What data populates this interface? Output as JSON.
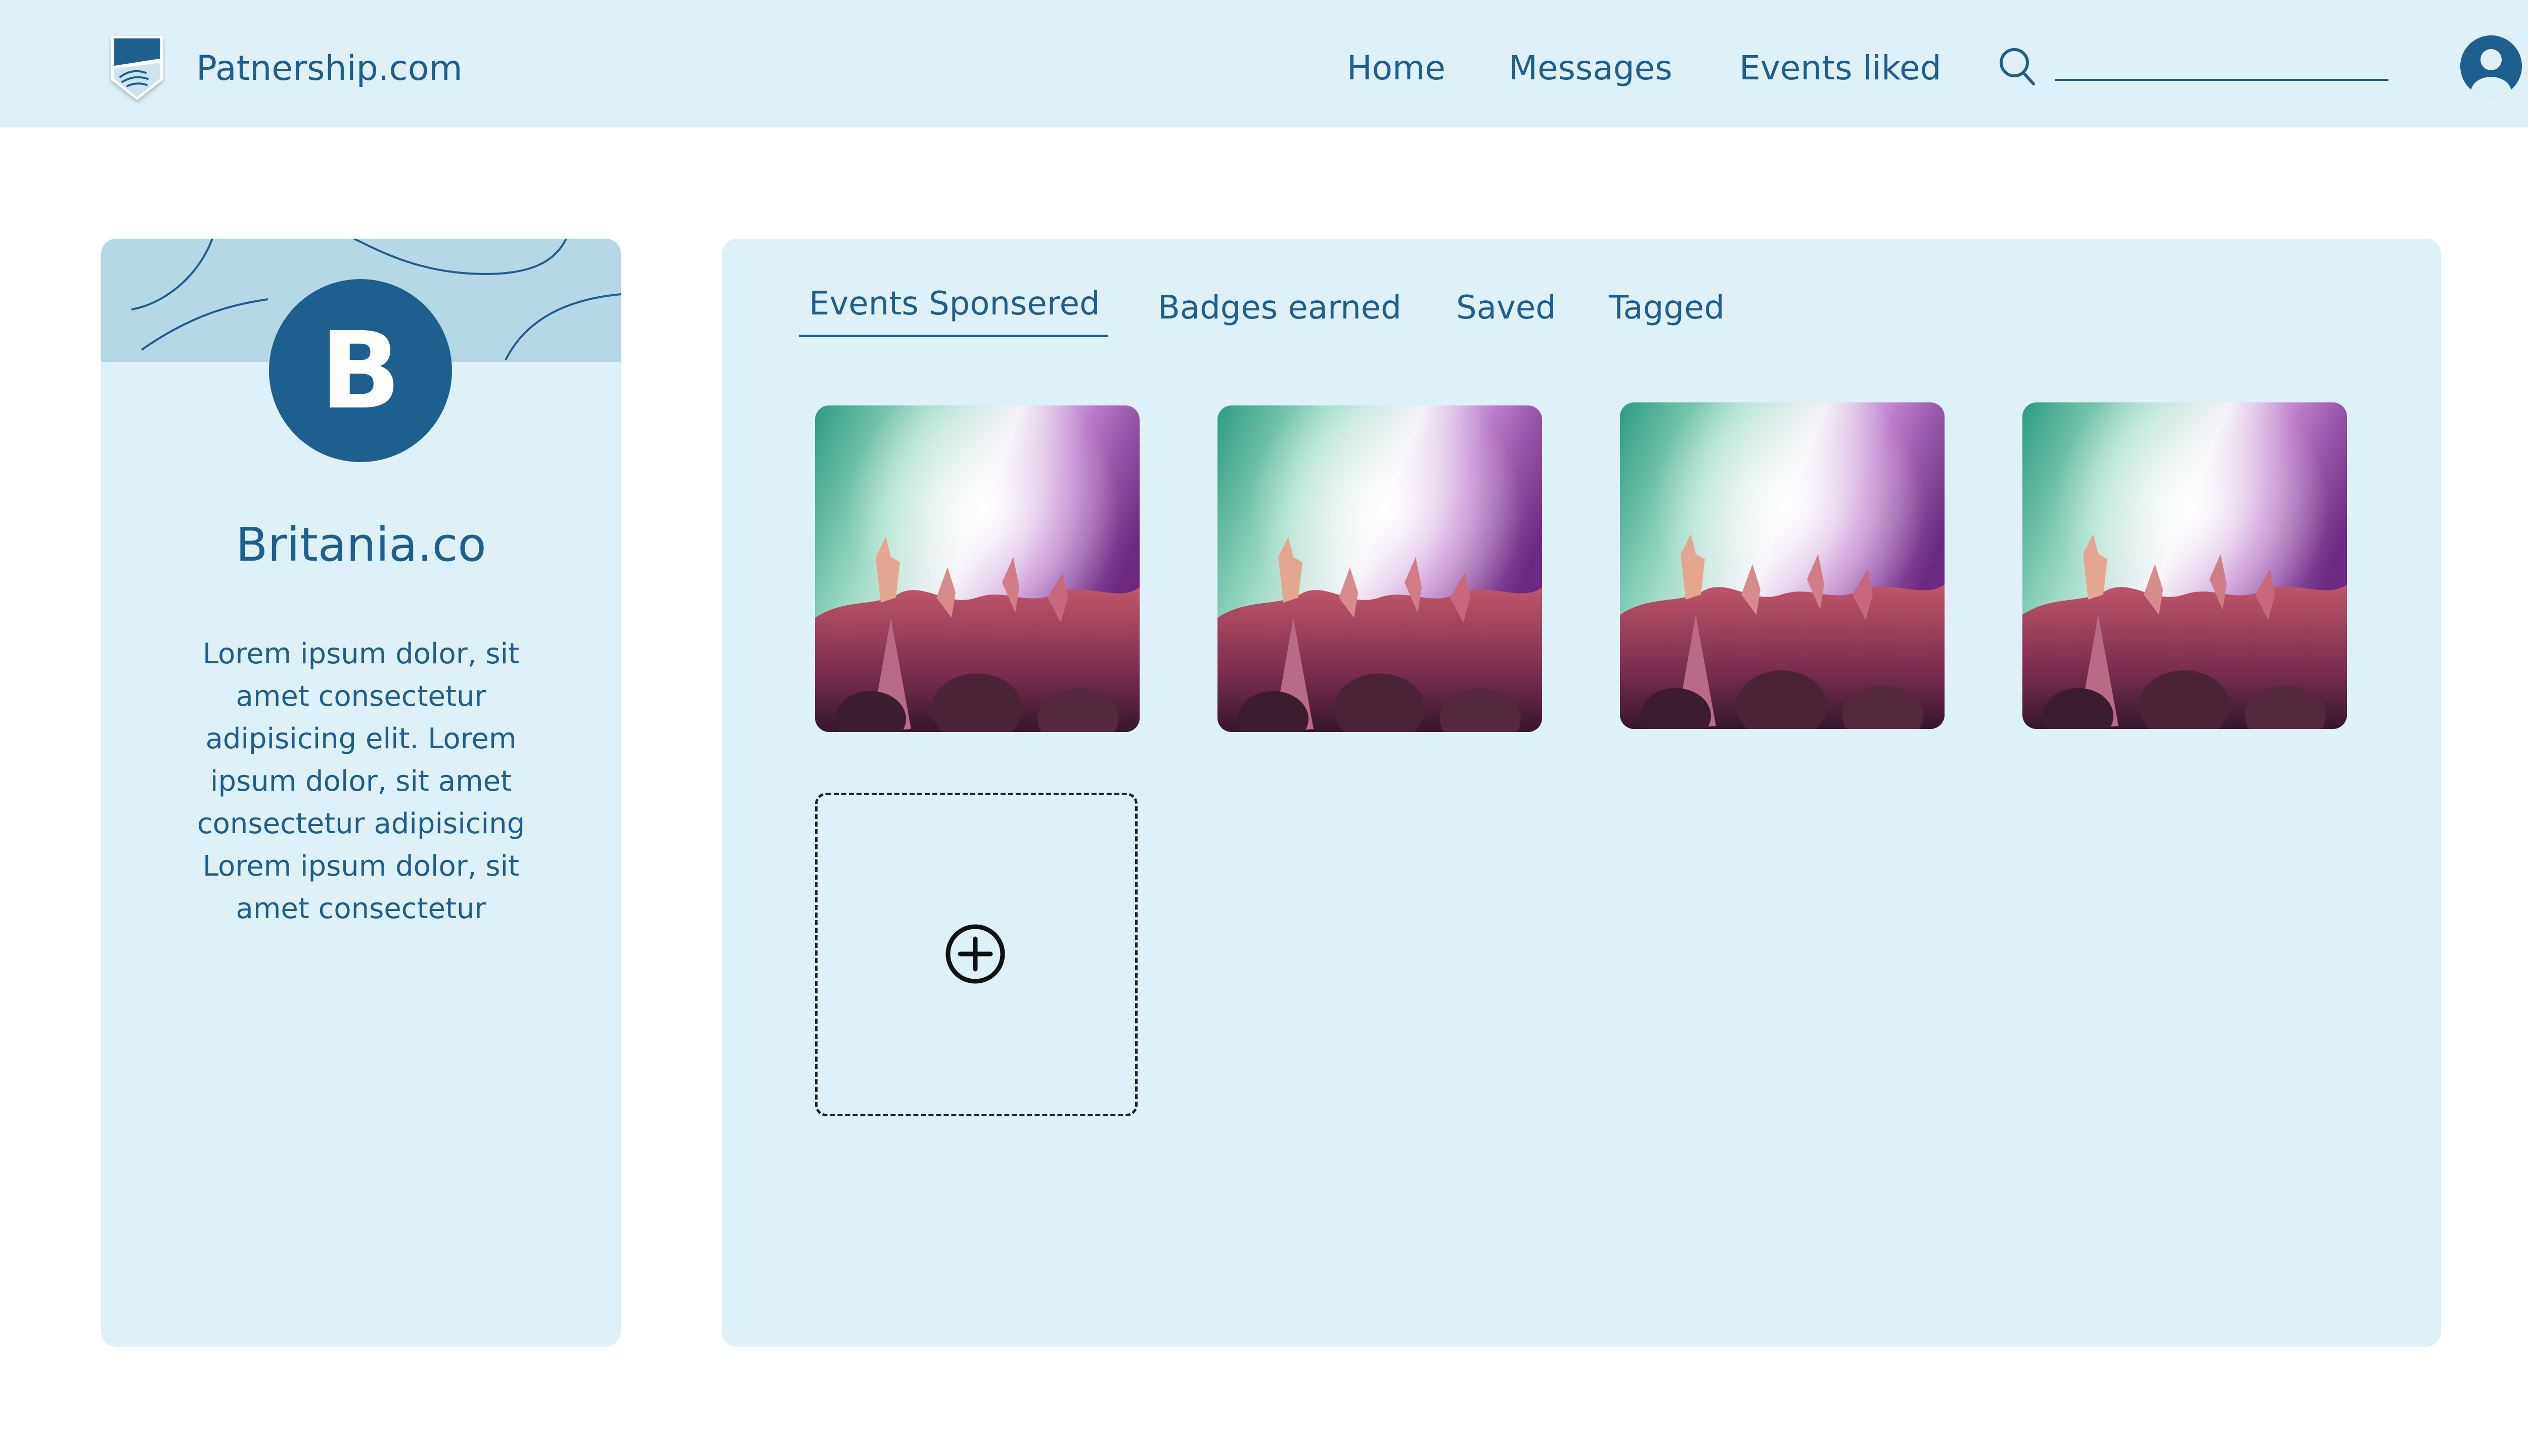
{
  "header": {
    "brand": "Patnership.com",
    "nav": [
      {
        "label": "Home"
      },
      {
        "label": "Messages"
      },
      {
        "label": "Events liked"
      }
    ],
    "search": {
      "placeholder": "",
      "value": ""
    }
  },
  "profile": {
    "avatar_letter": "B",
    "name": "Britania.co",
    "bio": "Lorem ipsum dolor, sit amet consectetur adipisicing elit. Lorem ipsum dolor, sit amet consectetur adipisicing Lorem ipsum dolor, sit amet consectetur"
  },
  "tabs": [
    {
      "label": "Events Sponsered",
      "active": true
    },
    {
      "label": "Badges earned",
      "active": false
    },
    {
      "label": "Saved",
      "active": false
    },
    {
      "label": "Tagged",
      "active": false
    }
  ],
  "events": [
    {
      "icon": "concert-crowd-image"
    },
    {
      "icon": "concert-crowd-image"
    },
    {
      "icon": "concert-crowd-image"
    },
    {
      "icon": "concert-crowd-image"
    }
  ],
  "add_tile": {
    "icon": "add-circle-icon"
  },
  "colors": {
    "primary": "#1d5f8e",
    "header_bg": "#def0f8",
    "card_bg": "#def0f8",
    "banner_bg": "#b5d8e5"
  }
}
